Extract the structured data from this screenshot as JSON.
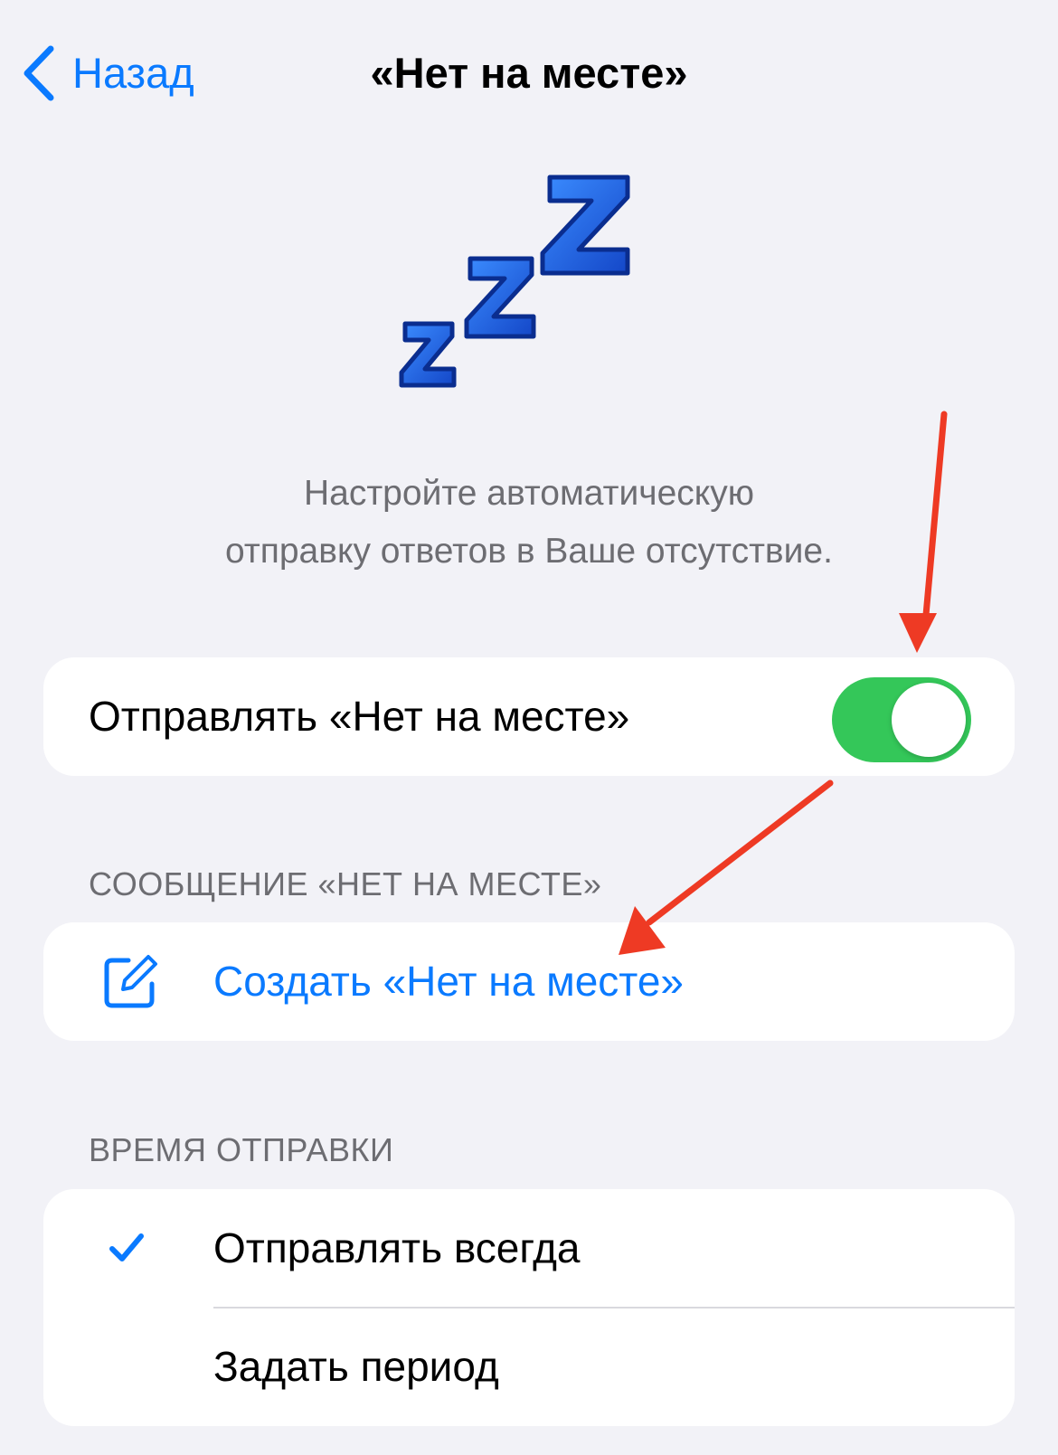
{
  "nav": {
    "back_label": "Назад",
    "title": "«Нет на месте»"
  },
  "description": {
    "line1": "Настройте автоматическую",
    "line2": "отправку ответов в Ваше отсутствие."
  },
  "toggle_row": {
    "label": "Отправлять «Нет на месте»",
    "enabled": true
  },
  "message_section": {
    "header": "СООБЩЕНИЕ «НЕТ НА МЕСТЕ»",
    "compose_label": "Создать «Нет на месте»"
  },
  "timing_section": {
    "header": "ВРЕМЯ ОТПРАВКИ",
    "options": [
      {
        "label": "Отправлять всегда",
        "selected": true
      },
      {
        "label": "Задать период",
        "selected": false
      }
    ]
  },
  "colors": {
    "accent": "#0a7aff",
    "toggle_on": "#34c759",
    "annotation_arrow": "#ee3a24",
    "zzz_blue": "#1a5fe0"
  },
  "icons": [
    "chevron-left-icon",
    "zzz-sleep-icon",
    "compose-icon",
    "checkmark-icon"
  ]
}
